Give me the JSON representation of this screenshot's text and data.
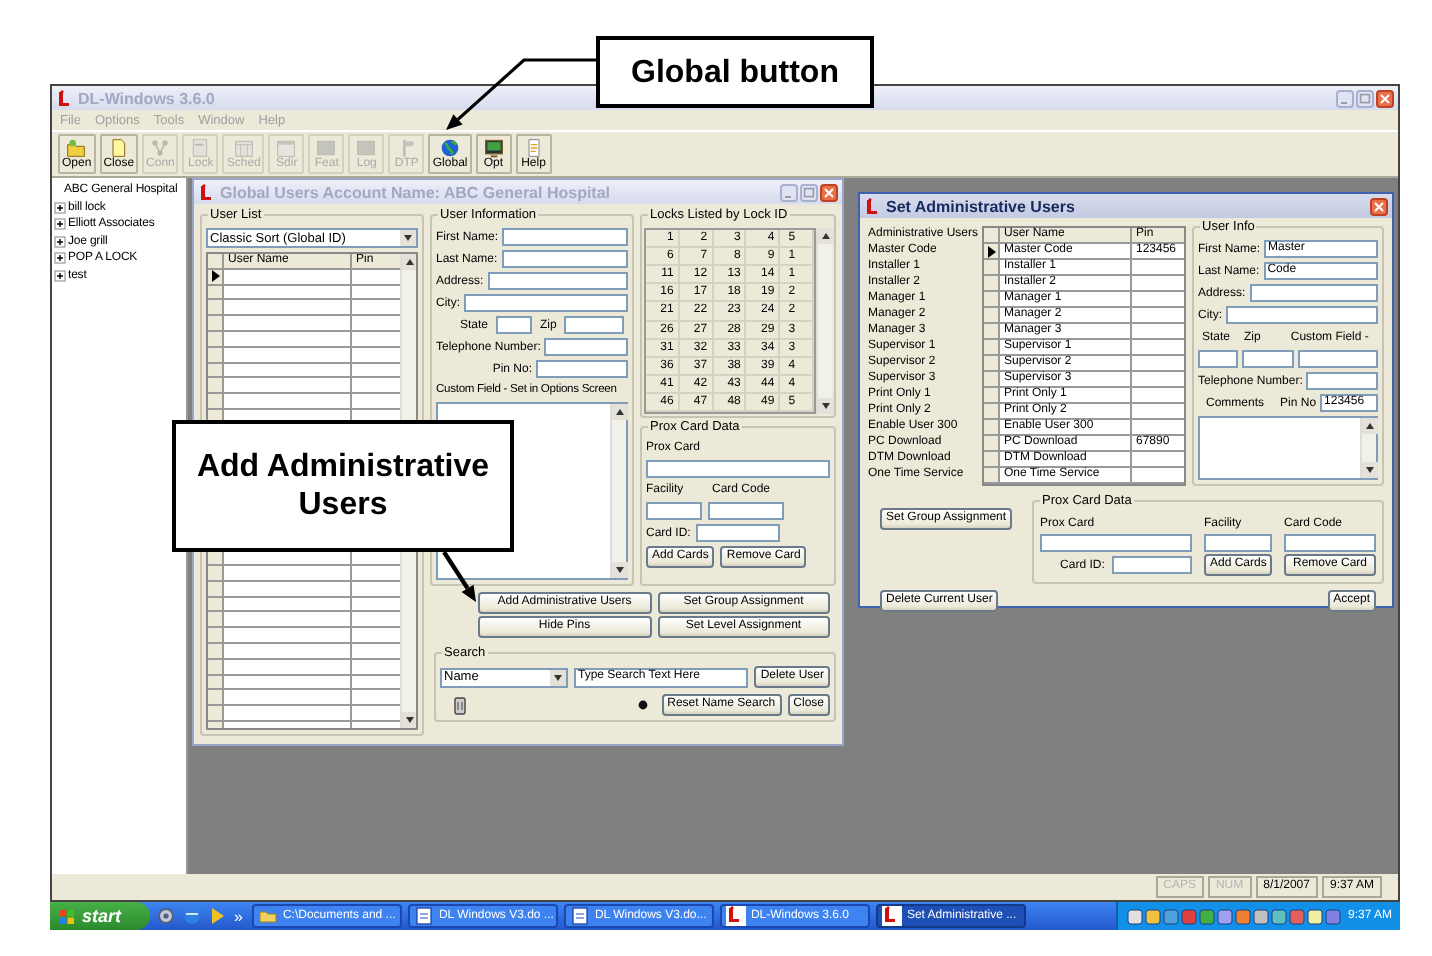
{
  "callouts": [
    {
      "text": "Global button"
    },
    {
      "text": "Add Administrative Users"
    }
  ],
  "app": {
    "title": "DL-Windows 3.6.0",
    "active": false,
    "menu": [
      "File",
      "Options",
      "Tools",
      "Window",
      "Help"
    ],
    "toolbar": [
      {
        "label": "Open",
        "disabled": false
      },
      {
        "label": "Close",
        "disabled": false
      },
      {
        "label": "Conn",
        "disabled": true
      },
      {
        "label": "Lock",
        "disabled": true
      },
      {
        "label": "Sched",
        "disabled": true
      },
      {
        "label": "Sdir",
        "disabled": true
      },
      {
        "label": "Feat",
        "disabled": true
      },
      {
        "label": "Log",
        "disabled": true
      },
      {
        "label": "DTP",
        "disabled": true
      },
      {
        "label": "Global",
        "disabled": false
      },
      {
        "label": "Opt",
        "disabled": false
      },
      {
        "label": "Help",
        "disabled": false
      }
    ]
  },
  "tree": [
    {
      "label": "ABC General Hospital",
      "expandable": false
    },
    {
      "label": "bill lock",
      "expandable": true
    },
    {
      "label": "Elliott Associates",
      "expandable": true
    },
    {
      "label": "Joe grill",
      "expandable": true
    },
    {
      "label": "POP A LOCK",
      "expandable": true
    },
    {
      "label": "test",
      "expandable": true
    }
  ],
  "global_window": {
    "title": "Global Users Account Name: ABC General Hospital",
    "active": false,
    "user_list": {
      "title": "User List",
      "sort": "Classic Sort (Global ID)",
      "columns": [
        "User Name",
        "Pin"
      ],
      "rows": [
        {
          "selected": true
        },
        {
          "selected": false
        },
        {
          "selected": false
        },
        {
          "selected": false
        },
        {
          "selected": false
        },
        {
          "selected": false
        },
        {
          "selected": false
        },
        {
          "selected": false
        },
        {
          "selected": false
        },
        {
          "selected": false
        }
      ],
      "rows_below": [
        {
          "selected": false
        },
        {
          "selected": false
        },
        {
          "selected": false
        },
        {
          "selected": false
        },
        {
          "selected": false
        },
        {
          "selected": false
        },
        {
          "selected": false
        },
        {
          "selected": false
        },
        {
          "selected": false
        },
        {
          "selected": false
        },
        {
          "selected": false
        },
        {
          "selected": false
        }
      ]
    },
    "user_info": {
      "title": "User Information",
      "rows": [
        {
          "kind": "wide",
          "labels": [
            "First Name:"
          ]
        },
        {
          "kind": "wide",
          "labels": [
            "Last Name:"
          ]
        },
        {
          "kind": "wide",
          "labels": [
            "Address:"
          ]
        },
        {
          "kind": "wide",
          "labels": [
            "City:"
          ]
        },
        {
          "kind": "pair",
          "labels": [
            "State",
            "Zip"
          ]
        },
        {
          "kind": "wide",
          "labels": [
            "Telephone Number:"
          ]
        },
        {
          "kind": "right",
          "labels": [
            "Pin No:"
          ]
        }
      ],
      "custom_label": "Custom Field - Set in Options Screen"
    },
    "locks": {
      "title": "Locks Listed by Lock ID",
      "rows": [
        [
          "1",
          "2",
          "3",
          "4",
          "5"
        ],
        [
          "6",
          "7",
          "8",
          "9",
          "1"
        ],
        [
          "11",
          "12",
          "13",
          "14",
          "1"
        ],
        [
          "16",
          "17",
          "18",
          "19",
          "2"
        ],
        [
          "21",
          "22",
          "23",
          "24",
          "2"
        ],
        [
          "26",
          "27",
          "28",
          "29",
          "3"
        ],
        [
          "31",
          "32",
          "33",
          "34",
          "3"
        ],
        [
          "36",
          "37",
          "38",
          "39",
          "4"
        ],
        [
          "41",
          "42",
          "43",
          "44",
          "4"
        ],
        [
          "46",
          "47",
          "48",
          "49",
          "5"
        ]
      ]
    },
    "prox": {
      "title": "Prox Card Data",
      "card_label": "Prox Card",
      "facility": "Facility",
      "card_code": "Card Code",
      "card_id": "Card ID:",
      "add": "Add Cards",
      "remove": "Remove Card"
    },
    "buttons": [
      "Add Administrative Users",
      "Set Group Assignment",
      "Hide Pins",
      "Set Level Assignment"
    ],
    "search": {
      "title": "Search",
      "field": "Name",
      "text": "Type Search Text Here",
      "buttons": [
        "Delete User",
        "Reset Name Search",
        "Close"
      ]
    }
  },
  "admin_window": {
    "title": "Set Administrative Users",
    "active": true,
    "list_title": "Administrative Users",
    "roles": [
      "Master Code",
      "Installer 1",
      "Installer 2",
      "Manager 1",
      "Manager 2",
      "Manager 3",
      "Supervisor 1",
      "Supervisor 2",
      "Supervisor 3",
      "Print Only 1",
      "Print Only 2",
      "Enable User 300",
      "PC Download",
      "DTM Download",
      "One Time Service"
    ],
    "columns": [
      "User Name",
      "Pin"
    ],
    "users": [
      {
        "name": "Master Code",
        "pin": "123456",
        "selected": true
      },
      {
        "name": "Installer 1",
        "selected": false
      },
      {
        "name": "Installer 2",
        "selected": false
      },
      {
        "name": "Manager 1",
        "selected": false
      },
      {
        "name": "Manager 2",
        "selected": false
      },
      {
        "name": "Manager 3",
        "selected": false
      },
      {
        "name": "Supervisor 1",
        "selected": false
      },
      {
        "name": "Supervisor 2",
        "selected": false
      },
      {
        "name": "Supervisor 3",
        "selected": false
      },
      {
        "name": "Print Only 1",
        "selected": false
      },
      {
        "name": "Print Only 2",
        "selected": false
      },
      {
        "name": "Enable User 300",
        "selected": false
      },
      {
        "name": "PC Download",
        "pin": "67890",
        "selected": false
      },
      {
        "name": "DTM Download",
        "selected": false
      },
      {
        "name": "One Time Service",
        "selected": false
      }
    ],
    "info": {
      "title": "User Info",
      "first_label": "First Name:",
      "first": "Master",
      "last_label": "Last Name:",
      "last": "Code",
      "address": "Address:",
      "city": "City:",
      "state": "State",
      "zip": "Zip",
      "custom": "Custom Field -",
      "phone": "Telephone Number:",
      "comments": "Comments",
      "pin_label": "Pin No",
      "pin": "123456"
    },
    "group_button": "Set Group Assignment",
    "prox": {
      "title": "Prox Card Data",
      "card_label": "Prox Card",
      "facility": "Facility",
      "card_code": "Card Code",
      "card_id": "Card ID:",
      "add": "Add Cards",
      "remove": "Remove Card"
    },
    "delete": "Delete Current User",
    "accept": "Accept"
  },
  "status_bar": [
    {
      "text": "CAPS",
      "disabled": true
    },
    {
      "text": "NUM",
      "disabled": true
    },
    {
      "text": "8/1/2007",
      "disabled": false
    },
    {
      "text": "9:37 AM",
      "disabled": false
    }
  ],
  "taskbar": {
    "start": "start",
    "overflow": "»",
    "tasks": [
      {
        "label": "C:\\Documents and ...",
        "selected": false
      },
      {
        "label": "DL Windows V3.do ...",
        "selected": false
      },
      {
        "label": "DL Windows V3.do...",
        "selected": false
      },
      {
        "label": "DL-Windows 3.6.0",
        "selected": false
      },
      {
        "label": "Set Administrative ...",
        "selected": true
      }
    ],
    "clock": "9:37 AM"
  }
}
